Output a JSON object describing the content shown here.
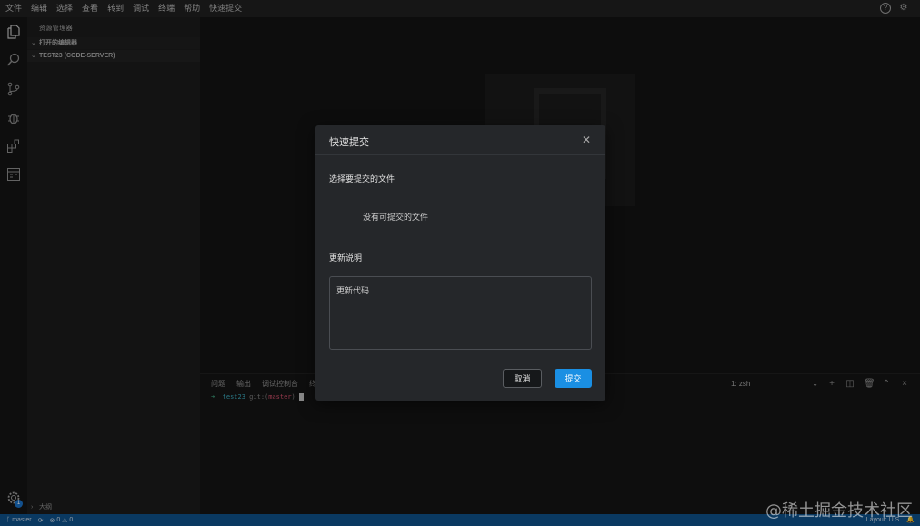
{
  "menu": [
    "文件",
    "编辑",
    "选择",
    "查看",
    "转到",
    "调试",
    "终端",
    "帮助",
    "快速提交"
  ],
  "explorer": {
    "title": "资源管理器",
    "open_editors": "打开的编辑器",
    "workspace": "TEST23 (CODE-SERVER)",
    "outline": "大纲"
  },
  "activity_icons": [
    "files-icon",
    "search-icon",
    "source-control-icon",
    "debug-icon",
    "extensions-icon",
    "preview-icon"
  ],
  "settings_badge": "1",
  "panel": {
    "tabs": [
      "问题",
      "输出",
      "调试控制台",
      "终"
    ],
    "terminal": {
      "arrow": "➜",
      "dir": "test23",
      "git": "git:(",
      "branch": "master",
      "git_end": ")"
    },
    "terminal_select": "1: zsh"
  },
  "status": {
    "branch": "master",
    "errors": "0",
    "warnings": "0",
    "layout": "Layout: U.S."
  },
  "dialog": {
    "title": "快速提交",
    "files_label": "选择要提交的文件",
    "no_files": "没有可提交的文件",
    "desc_label": "更新说明",
    "desc_value": "更新代码",
    "cancel": "取消",
    "submit": "提交"
  },
  "watermark": "@稀土掘金技术社区",
  "colors": {
    "accent": "#1a8fe3",
    "statusbar": "#0f4f87"
  }
}
